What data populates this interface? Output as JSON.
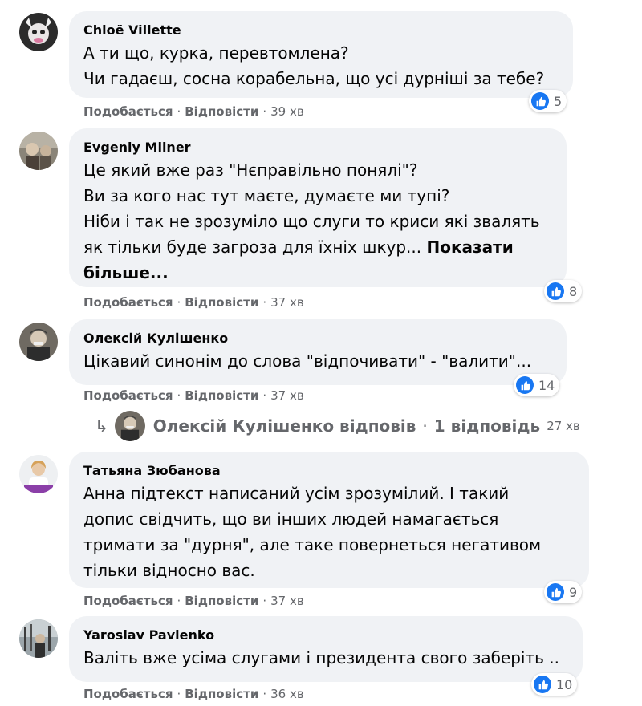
{
  "comments": [
    {
      "author": "Chloë Villette",
      "text": "А ти що, курка, перевтомлена?\nЧи гадаєш, сосна корабельна, що усі дурніші за тебе?",
      "see_more": "",
      "reactions": "5",
      "like_label": "Подобається",
      "reply_label": "Відповісти",
      "time": "39 хв"
    },
    {
      "author": "Evgeniy Milner",
      "text": "Це який вже раз \"Нєправільно понялі\"?\nВи за кого нас тут маєте, думаєте ми тупі?\nНіби і так не зрозуміло що слуги то криси які звалять\nяк тільки буде загроза для їхніх шкур... ",
      "see_more": "Показати більше...",
      "reactions": "8",
      "like_label": "Подобається",
      "reply_label": "Відповісти",
      "time": "37 хв"
    },
    {
      "author": "Олексій Кулішенко",
      "text": "Цікавий синонім до слова \"відпочивати\" - \"валити\"...",
      "see_more": "",
      "reactions": "14",
      "like_label": "Подобається",
      "reply_label": "Відповісти",
      "time": "37 хв"
    },
    {
      "author": "Татьяна Зюбанова",
      "text": "Анна підтекст написаний усім зрозумілий. І такий\nдопис свідчить, що ви інших людей намагається\nтримати за \"дурня\", але таке повернеться негативом\nтільки відносно вас.",
      "see_more": "",
      "reactions": "9",
      "like_label": "Подобається",
      "reply_label": "Відповісти",
      "time": "37 хв"
    },
    {
      "author": "Yaroslav Pavlenko",
      "text": "Валіть вже усіма слугами і президента свого заберіть ..",
      "see_more": "",
      "reactions": "10",
      "like_label": "Подобається",
      "reply_label": "Відповісти",
      "time": "36 хв"
    }
  ],
  "reply_thread": {
    "replier": "Олексій Кулішенко відповів",
    "count": "1 відповідь",
    "time": "27 хв"
  },
  "icons": {
    "like": "like-thumb-icon",
    "reply_arrow": "reply-arrow-icon"
  },
  "colors": {
    "like_blue": "#1877f2",
    "bubble_bg": "#f0f2f5",
    "secondary_text": "#65676b"
  }
}
